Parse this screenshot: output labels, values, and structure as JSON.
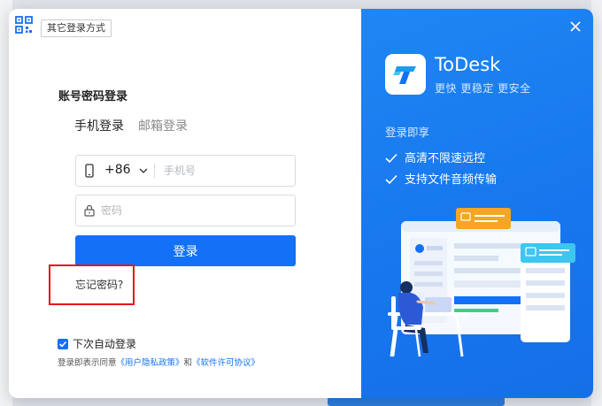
{
  "other_login_label": "其它登录方式",
  "section_title": "账号密码登录",
  "tabs": [
    {
      "label": "手机登录",
      "active": true
    },
    {
      "label": "邮箱登录",
      "active": false
    }
  ],
  "phone": {
    "country_code": "+86",
    "placeholder": "手机号",
    "value": ""
  },
  "password": {
    "placeholder": "密码",
    "value": ""
  },
  "login_button": "登录",
  "forgot_password": "忘记密码?",
  "auto_login": {
    "label": "下次自动登录",
    "checked": true
  },
  "agreement": {
    "prefix": "登录即表示同意",
    "privacy_link": "《用户隐私政策》",
    "and": "和",
    "license_link": "《软件许可协议》"
  },
  "brand": {
    "name": "ToDesk",
    "tagline": "更快 更稳定 更安全"
  },
  "promo": {
    "heading": "登录即享",
    "features": [
      "高清不限速远控",
      "支持文件音频传输"
    ]
  },
  "colors": {
    "primary": "#1271f7",
    "panel_blue": "#1777ee",
    "highlight_red": "#e4141b",
    "accent_orange": "#f5a623",
    "accent_cyan": "#3ec5f0"
  },
  "icons": [
    "qr-code-icon",
    "mobile-phone-icon",
    "chevron-down-icon",
    "lock-icon",
    "checkmark-icon",
    "close-icon",
    "todesk-logo-icon"
  ]
}
